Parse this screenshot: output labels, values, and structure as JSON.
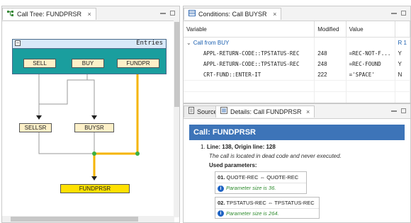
{
  "call_tree": {
    "tab_title": "Call Tree: FUNDPRSR",
    "entries_label": "Entries",
    "nodes": {
      "sell": "SELL",
      "buy": "BUY",
      "fundpr": "FUNDPR",
      "sellsr": "SELLSR",
      "buysr": "BUYSR",
      "fundprsr": "FUNDPRSR"
    },
    "highlight_color": "#f5b400"
  },
  "conditions": {
    "tab_title": "Conditions: Call BUYSR",
    "columns": [
      "Variable",
      "Modified",
      "Value",
      ""
    ],
    "group_label": "Call from BUY",
    "group_ref": "R 1",
    "rows": [
      {
        "variable": "APPL-RETURN-CODE::TPSTATUS-REC",
        "modified": "248",
        "value": "=REC-NOT-F...",
        "flag": "Y"
      },
      {
        "variable": "APPL-RETURN-CODE::TPSTATUS-REC",
        "modified": "248",
        "value": "=REC-FOUND",
        "flag": "Y"
      },
      {
        "variable": "CRT-FUND::ENTER-IT",
        "modified": "222",
        "value": "='SPACE'",
        "flag": "N"
      }
    ]
  },
  "details": {
    "tabs": [
      "Source",
      "Details: Call FUNDPRSR"
    ],
    "banner": "Call: FUNDPRSR",
    "item_no": "1.",
    "line_text": "Line: 138, Origin line: 128",
    "dead_code_note": "The call is located in dead code and never executed.",
    "used_params_label": "Used parameters:",
    "params": [
      {
        "num": "01.",
        "mapping": "QUOTE-REC ⇔ QUOTE-REC",
        "note": "Parameter size is 36."
      },
      {
        "num": "02.",
        "mapping": "TPSTATUS-REC ⇔ TPSTATUS-REC",
        "note": "Parameter size is 264."
      }
    ]
  }
}
